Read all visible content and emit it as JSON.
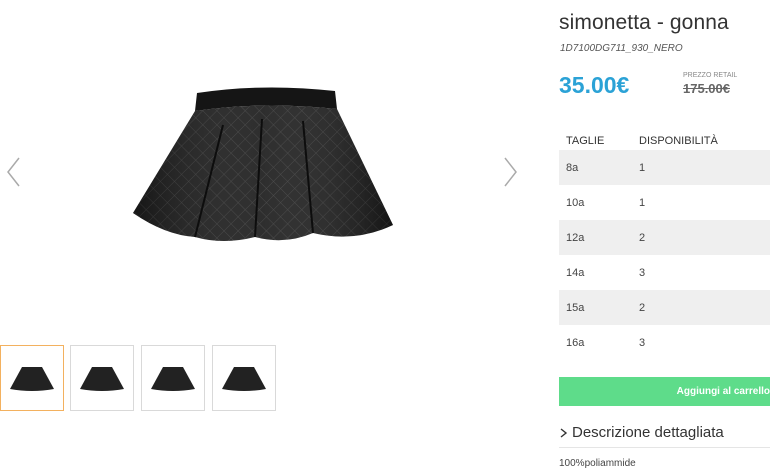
{
  "product": {
    "title": "simonetta - gonna",
    "sku": "1D7100DG711_930_NERO",
    "price": "35.00€",
    "retail_label": "PREZZO RETAIL",
    "retail_price": "175.00€"
  },
  "gallery": {
    "image_alt": "black quilted skirt",
    "prev_icon": "chevron-left-icon",
    "next_icon": "chevron-right-icon",
    "thumb_count": 4,
    "active_thumb": 0
  },
  "size_table": {
    "headers": {
      "size": "TAGLIE",
      "availability": "DISPONIBILITÀ"
    },
    "rows": [
      {
        "size": "8a",
        "availability": "1"
      },
      {
        "size": "10a",
        "availability": "1"
      },
      {
        "size": "12a",
        "availability": "2"
      },
      {
        "size": "14a",
        "availability": "3"
      },
      {
        "size": "15a",
        "availability": "2"
      },
      {
        "size": "16a",
        "availability": "3"
      }
    ]
  },
  "actions": {
    "add_to_cart": "Aggiungi al carrello"
  },
  "description": {
    "toggle_label": "Descrizione dettagliata",
    "text": "100%poliammide"
  },
  "colors": {
    "price": "#2ba2d6",
    "cart_button": "#5edc8a",
    "active_thumb_border": "#f3b15f",
    "row_shade": "#efefef"
  }
}
